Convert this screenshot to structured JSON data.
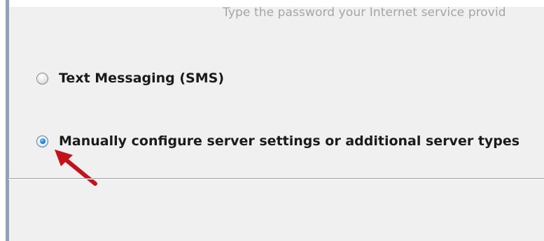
{
  "dialog": {
    "hint_text": "Type the password your Internet service provid"
  },
  "options": [
    {
      "label": "Text Messaging (SMS)",
      "checked": false
    },
    {
      "label": "Manually configure server settings or additional server types",
      "checked": true
    }
  ],
  "annotation": {
    "arrow_color": "#c0141a"
  },
  "colors": {
    "dialog_background": "#f0f0f0",
    "left_border": "#8ea1bd",
    "selected_radio": "#1f7fd6"
  }
}
